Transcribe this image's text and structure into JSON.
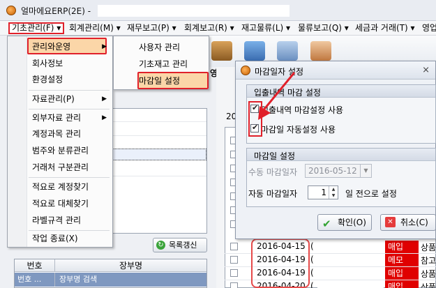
{
  "window": {
    "title": "얼마에요ERP(2E) -",
    "colors": {
      "highlight": "#e0202a",
      "menu_hover": "#fbd6a8"
    }
  },
  "menubar": {
    "items": [
      {
        "label": "기초관리(F) ▾"
      },
      {
        "label": "회계관리(M) ▾"
      },
      {
        "label": "재무보고(P) ▾"
      },
      {
        "label": "회계보고(R) ▾"
      },
      {
        "label": "재고물류(L) ▾"
      },
      {
        "label": "물류보고(Q) ▾"
      },
      {
        "label": "세금과 거래(T) ▾"
      },
      {
        "label": "영업"
      }
    ]
  },
  "main_menu": {
    "items": [
      {
        "label": "관리와운영",
        "arrow": "▶"
      },
      {
        "label": "회사정보"
      },
      {
        "label": "환경설정"
      },
      {
        "label": "자료관리(P)",
        "arrow": "▶"
      },
      {
        "label": "외부자료 관리",
        "arrow": "▶"
      },
      {
        "label": "계정과목 관리"
      },
      {
        "label": "범주와 분류관리"
      },
      {
        "label": "거래처 구분관리"
      },
      {
        "label": "적요로 계정찾기"
      },
      {
        "label": "적요로 대체찾기"
      },
      {
        "label": "라벨규격 관리"
      },
      {
        "label": "작업 종료(X)"
      }
    ]
  },
  "sub_menu": {
    "items": [
      {
        "label": "사용자 관리"
      },
      {
        "label": "기초재고 관리"
      },
      {
        "label": "마감일 설정"
      }
    ]
  },
  "toolbar": {
    "sales_label": "영업"
  },
  "left": {
    "refresh_button": "목록갱신",
    "book_table": {
      "col_no": "번호",
      "col_name": "장부명",
      "row_no": "번호 ...",
      "row_name": "장부명 검색"
    }
  },
  "grid": {
    "year_prefix": "20",
    "rows": [
      {
        "date": "2016-04-15",
        "mid": "(",
        "type": "매입",
        "type_color": "#e00000",
        "desc": "상품"
      },
      {
        "date": "2016-04-19",
        "mid": "(",
        "type": "메모",
        "type_color": "#e00000",
        "desc": "참고"
      },
      {
        "date": "2016-04-19",
        "mid": "(",
        "type": "매입",
        "type_color": "#e00000",
        "desc": "상품"
      },
      {
        "date": "2016-04-20",
        "mid": "(",
        "type": "매입",
        "type_color": "#e00000",
        "desc": "상품"
      }
    ]
  },
  "dialog": {
    "title": "마감일자 설정",
    "group1": {
      "title": "입출내역 마감 설정",
      "opt1": "입출내역 마감설정 사용",
      "opt2": "마감일 자동설정 사용"
    },
    "group2": {
      "title": "마감일 설정",
      "manual_label": "수동 마감일자",
      "manual_value": "2016-05-12",
      "auto_label": "자동 마감일자",
      "auto_value": "1",
      "auto_suffix": "일 전으로 설정"
    },
    "ok_label": "확인(O)",
    "cancel_label": "취소(C)"
  }
}
